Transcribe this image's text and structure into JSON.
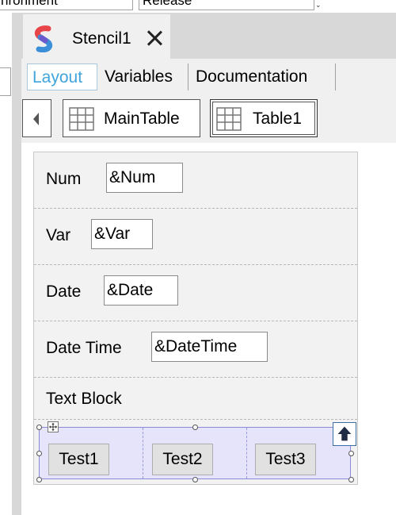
{
  "top_toolbar": {
    "left_field_text": "nronment",
    "right_field_text": "Release",
    "dropdown_glyph": "⌄"
  },
  "document_tab": {
    "title": "Stencil1",
    "icon": "stencil-logo-icon",
    "close_icon": "close-icon"
  },
  "sub_tabs": [
    {
      "label": "Layout",
      "active": true
    },
    {
      "label": "Variables",
      "active": false
    },
    {
      "label": "Documentation",
      "active": false
    }
  ],
  "table_nav": {
    "back_icon": "chevron-left-icon",
    "tables": [
      {
        "label": "MainTable",
        "icon": "grid-icon",
        "selected": false
      },
      {
        "label": "Table1",
        "icon": "grid-icon",
        "selected": true
      }
    ]
  },
  "form": {
    "rows": [
      {
        "label": "Num",
        "value": "&Num"
      },
      {
        "label": "Var",
        "value": "&Var"
      },
      {
        "label": "Date",
        "value": "&Date"
      },
      {
        "label": "Date Time",
        "value": "&DateTime"
      },
      {
        "label": "Text Block"
      }
    ],
    "selected_row": {
      "buttons": [
        "Test1",
        "Test2",
        "Test3"
      ],
      "move_icon": "move-icon",
      "up_icon": "arrow-up-icon"
    }
  },
  "colors": {
    "active_tab_text": "#3fa4dc",
    "selection_fill": "#e6e4fb",
    "logo_red": "#e8454a",
    "logo_blue": "#3b8fd9"
  }
}
